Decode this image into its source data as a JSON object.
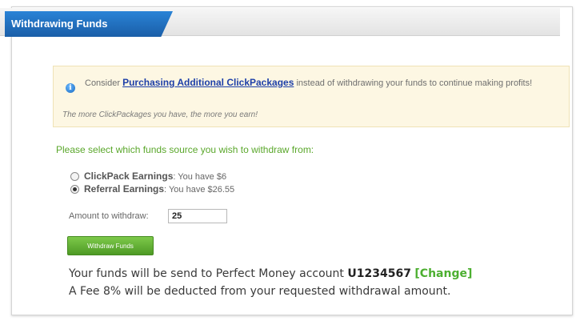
{
  "header": {
    "title": "Withdrawing Funds"
  },
  "info": {
    "prefix": "Consider",
    "link": "Purchasing Additional ClickPackages",
    "suffix": "instead of withdrawing your funds to continue making profits!",
    "note": "The more ClickPackages you have, the more you earn!"
  },
  "form": {
    "heading": "Please select which funds source you wish to withdraw from:",
    "options": [
      {
        "label": "ClickPack Earnings",
        "detail": ": You have $6",
        "selected": false
      },
      {
        "label": "Referral Earnings",
        "detail": ": You have $26.55",
        "selected": true
      }
    ],
    "amount_label": "Amount to withdraw:",
    "amount_value": "25",
    "button_label": "Withdraw Funds"
  },
  "notice": {
    "line1_prefix": "Your funds will be send to Perfect Money account",
    "account_id": "U1234567",
    "bracket_open": "[",
    "change_label": "Change",
    "bracket_close": "]",
    "line2": "A Fee 8% will be deducted from your requested withdrawal amount."
  },
  "colors": {
    "accent_blue": "#1a5ea8",
    "accent_green": "#5aa72b",
    "info_bg": "#fdf7e3"
  }
}
